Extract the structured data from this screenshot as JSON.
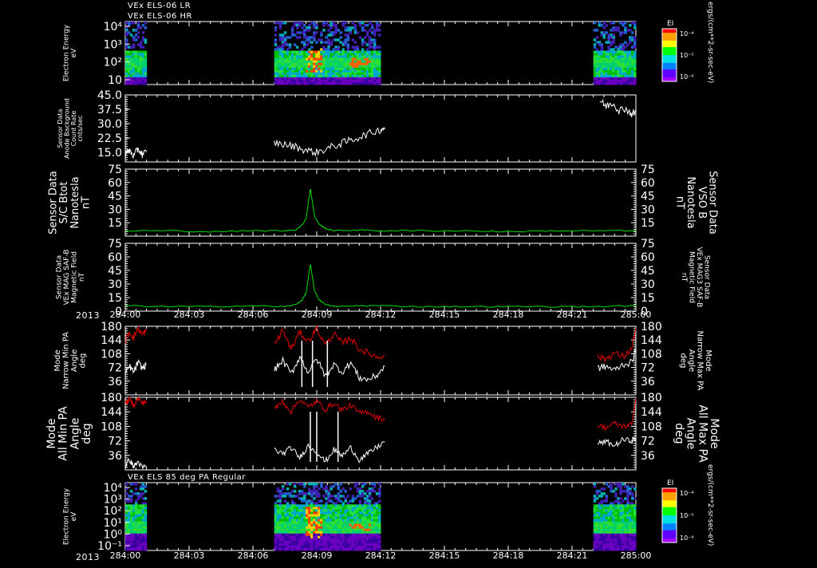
{
  "header": {
    "line1": "VEx ELS-06 LR",
    "line2": "VEx ELS-06 HR",
    "bottom_panel_title": "VEx ELS 85 deg PA Regular",
    "colorbar_units": "ergs/(cm**2-sr-sec-eV)",
    "colorbar_label": "EI"
  },
  "colors": {
    "white": "#ffffff",
    "green": "#00e000",
    "red": "#e00000",
    "background": "#000000"
  },
  "time_axis": {
    "year": "2013",
    "ticks": [
      "284:00",
      "284:03",
      "284:06",
      "284:09",
      "284:12",
      "284:15",
      "284:18",
      "284:21",
      "285:00"
    ]
  },
  "colorbar": {
    "ticks": [
      "10⁻⁴",
      "10⁻⁵",
      "10⁻⁶"
    ]
  },
  "chart_data": [
    {
      "type": "heatmap",
      "title": "VEx ELS-06 LR / VEx ELS-06 HR",
      "ylabel": [
        "Electron Energy",
        "eV"
      ],
      "yticks": [
        "10⁴",
        "10³",
        "10²",
        "10"
      ],
      "ylim_log": [
        1,
        4
      ],
      "data_intervals": [
        [
          "284:00",
          "284:01"
        ],
        [
          "284:07",
          "284:12"
        ],
        [
          "284:22",
          "285:00"
        ]
      ],
      "colorbar_label": "EI"
    },
    {
      "type": "line",
      "ylabel": [
        "Sensor Data",
        "Anode Background",
        "Count Rate",
        "cnts/sec"
      ],
      "yticks": [
        "45.0",
        "37.5",
        "30.0",
        "22.5",
        "15.0"
      ],
      "ylim": [
        10,
        45
      ],
      "series": [
        {
          "color": "#ffffff",
          "segments": [
            {
              "t": [
                0.0,
                0.2,
                0.4,
                0.6,
                0.8,
                1.0
              ],
              "y": [
                14,
                16,
                13,
                17,
                14,
                15
              ]
            },
            {
              "t": [
                7.0,
                7.5,
                8.0,
                8.5,
                9.0,
                9.5,
                10.0,
                10.5,
                11.0,
                11.5,
                12.0,
                12.2
              ],
              "y": [
                20,
                19,
                18,
                16,
                15,
                17,
                19,
                21,
                23,
                25,
                27,
                28
              ]
            },
            {
              "t": [
                22.3,
                22.6,
                22.9,
                23.2,
                23.5,
                23.8,
                24.0
              ],
              "y": [
                42,
                39,
                41,
                37,
                38,
                35,
                36
              ]
            }
          ]
        }
      ]
    },
    {
      "type": "line",
      "ylabel": [
        "Sensor Data",
        "S/C Btot",
        "Nanotesla",
        "nT"
      ],
      "ylabel_right": [
        "Sensor Data",
        "VSO B",
        "Nanotesla",
        "nT"
      ],
      "yticks": [
        "75",
        "60",
        "45",
        "30",
        "15"
      ],
      "ylim": [
        0,
        75
      ],
      "series": [
        {
          "name": "VSO B",
          "color": "#00e000",
          "t": [
            0.0,
            2.0,
            4.0,
            6.0,
            7.5,
            8.0,
            8.3,
            8.5,
            8.7,
            8.9,
            9.1,
            9.3,
            9.6,
            10.0,
            11.0,
            12.0,
            14.0,
            16.0,
            18.0,
            20.0,
            22.0,
            24.0
          ],
          "y": [
            6,
            6,
            5,
            6,
            6,
            7,
            12,
            20,
            53,
            22,
            14,
            10,
            7,
            6,
            7,
            6,
            6,
            6,
            5,
            6,
            6,
            6
          ]
        }
      ]
    },
    {
      "type": "line",
      "ylabel": [
        "Sensor Data",
        "VEx MAG SAF-B",
        "Magnetic Field",
        "nT"
      ],
      "ylabel_right": [
        "Sensor Data",
        "VEx MAG3 SAF-B",
        "Magnetic Field",
        "nT"
      ],
      "yticks": [
        "75",
        "60",
        "45",
        "30",
        "15",
        "0"
      ],
      "ylim": [
        0,
        75
      ],
      "series": [
        {
          "name": "VEx MAG3 SAF-B",
          "color": "#00e000",
          "t": [
            0.0,
            2.0,
            4.0,
            6.0,
            7.5,
            8.0,
            8.3,
            8.5,
            8.7,
            8.9,
            9.1,
            9.3,
            9.6,
            10.0,
            11.0,
            12.0,
            14.0,
            16.0,
            18.0,
            20.0,
            22.0,
            24.0
          ],
          "y": [
            6,
            5,
            5,
            6,
            5,
            7,
            12,
            20,
            52,
            22,
            13,
            9,
            6,
            5,
            6,
            6,
            5,
            5,
            5,
            5,
            5,
            6
          ]
        }
      ]
    },
    {
      "type": "line",
      "ylabel": [
        "Mode",
        "Narrow Min PA",
        "Angle",
        "deg"
      ],
      "ylabel_right": [
        "Mode",
        "Narrow Max PA",
        "Angle",
        "deg"
      ],
      "yticks": [
        "180",
        "144",
        "108",
        "72",
        "36"
      ],
      "ylim": [
        0,
        180
      ],
      "series": [
        {
          "name": "Narrow Max PA",
          "color": "#e00000",
          "segments": [
            {
              "t": [
                0.0,
                0.2,
                0.4,
                0.6,
                0.8,
                1.0
              ],
              "y": [
                140,
                165,
                150,
                175,
                158,
                170
              ]
            },
            {
              "t": [
                7.0,
                7.4,
                7.8,
                8.2,
                8.6,
                9.0,
                9.4,
                9.8,
                10.2,
                10.6,
                11.0,
                11.4,
                11.8,
                12.2
              ],
              "y": [
                130,
                170,
                120,
                165,
                140,
                175,
                130,
                160,
                135,
                150,
                120,
                110,
                100,
                105
              ]
            },
            {
              "t": [
                22.2,
                22.6,
                23.0,
                23.4,
                23.8,
                24.0
              ],
              "y": [
                100,
                95,
                110,
                100,
                120,
                175
              ]
            }
          ]
        },
        {
          "name": "Narrow Min PA",
          "color": "#ffffff",
          "segments": [
            {
              "t": [
                0.0,
                0.2,
                0.4,
                0.6,
                0.8,
                1.0
              ],
              "y": [
                55,
                75,
                60,
                85,
                70,
                80
              ]
            },
            {
              "t": [
                7.0,
                7.4,
                7.8,
                8.2,
                8.6,
                9.0,
                9.4,
                9.8,
                10.2,
                10.6,
                11.0,
                11.4,
                11.8,
                12.2
              ],
              "y": [
                65,
                90,
                55,
                100,
                60,
                95,
                50,
                80,
                60,
                85,
                45,
                40,
                50,
                75
              ]
            },
            {
              "t": [
                22.2,
                22.6,
                23.0,
                23.4,
                23.8,
                24.0
              ],
              "y": [
                70,
                75,
                65,
                80,
                85,
                120
              ]
            }
          ]
        }
      ]
    },
    {
      "type": "line",
      "ylabel": [
        "Mode",
        "All Min PA",
        "Angle",
        "deg"
      ],
      "ylabel_right": [
        "Mode",
        "All Max PA",
        "Angle",
        "deg"
      ],
      "yticks": [
        "180",
        "144",
        "108",
        "72",
        "36"
      ],
      "ylim": [
        0,
        180
      ],
      "series": [
        {
          "name": "All Max PA",
          "color": "#e00000",
          "segments": [
            {
              "t": [
                0.0,
                0.2,
                0.4,
                0.6,
                0.8,
                1.0
              ],
              "y": [
                165,
                175,
                160,
                178,
                165,
                172
              ]
            },
            {
              "t": [
                7.0,
                7.4,
                7.8,
                8.2,
                8.6,
                9.0,
                9.4,
                9.8,
                10.2,
                10.6,
                11.0,
                11.4,
                11.8,
                12.2
              ],
              "y": [
                150,
                170,
                145,
                175,
                155,
                170,
                150,
                165,
                148,
                160,
                140,
                145,
                130,
                125
              ]
            },
            {
              "t": [
                22.2,
                22.6,
                23.0,
                23.4,
                23.8,
                24.0
              ],
              "y": [
                110,
                105,
                115,
                108,
                112,
                178
              ]
            }
          ]
        },
        {
          "name": "All Min PA",
          "color": "#ffffff",
          "segments": [
            {
              "t": [
                0.0,
                0.2,
                0.4,
                0.6,
                0.8,
                1.0
              ],
              "y": [
                10,
                25,
                8,
                20,
                5,
                10
              ]
            },
            {
              "t": [
                7.0,
                7.4,
                7.8,
                8.2,
                8.6,
                9.0,
                9.4,
                9.8,
                10.2,
                10.6,
                11.0,
                11.4,
                11.8,
                12.2
              ],
              "y": [
                50,
                40,
                55,
                30,
                60,
                45,
                20,
                50,
                35,
                55,
                25,
                40,
                55,
                70
              ]
            },
            {
              "t": [
                22.2,
                22.6,
                23.0,
                23.4,
                23.8,
                24.0
              ],
              "y": [
                65,
                70,
                60,
                75,
                72,
                80
              ]
            }
          ]
        }
      ]
    },
    {
      "type": "heatmap",
      "title": "VEx ELS 85 deg PA Regular",
      "ylabel": [
        "Electron Energy",
        "eV"
      ],
      "yticks": [
        "10⁴",
        "10³",
        "10²",
        "10¹",
        "10⁰",
        "10⁻¹"
      ],
      "ylim_log": [
        -1,
        4
      ],
      "data_intervals": [
        [
          "284:00",
          "284:01"
        ],
        [
          "284:07",
          "284:12"
        ],
        [
          "284:22",
          "285:00"
        ]
      ],
      "colorbar_label": "EI"
    }
  ]
}
